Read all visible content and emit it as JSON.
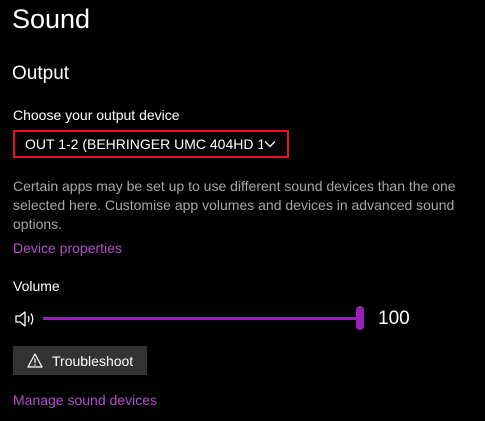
{
  "page": {
    "title": "Sound"
  },
  "output": {
    "section_title": "Output",
    "choose_label": "Choose your output device",
    "selected_device": "OUT 1-2 (BEHRINGER UMC 404HD 1...",
    "description": "Certain apps may be set up to use different sound devices than the one selected here. Customise app volumes and devices in advanced sound options.",
    "device_properties_link": "Device properties",
    "volume_label": "Volume",
    "volume_value": "100",
    "volume_level": 1.0,
    "troubleshoot_label": "Troubleshoot",
    "manage_devices_link": "Manage sound devices"
  },
  "icons": {
    "speaker": "speaker-icon",
    "chevron": "chevron-down-icon",
    "warning": "warning-icon"
  },
  "colors": {
    "accent": "#9b1fb8",
    "link": "#b24fc9",
    "focus_border": "#e81123",
    "background": "#000000",
    "button_bg": "#333333",
    "secondary_text": "#a6a6a6"
  }
}
